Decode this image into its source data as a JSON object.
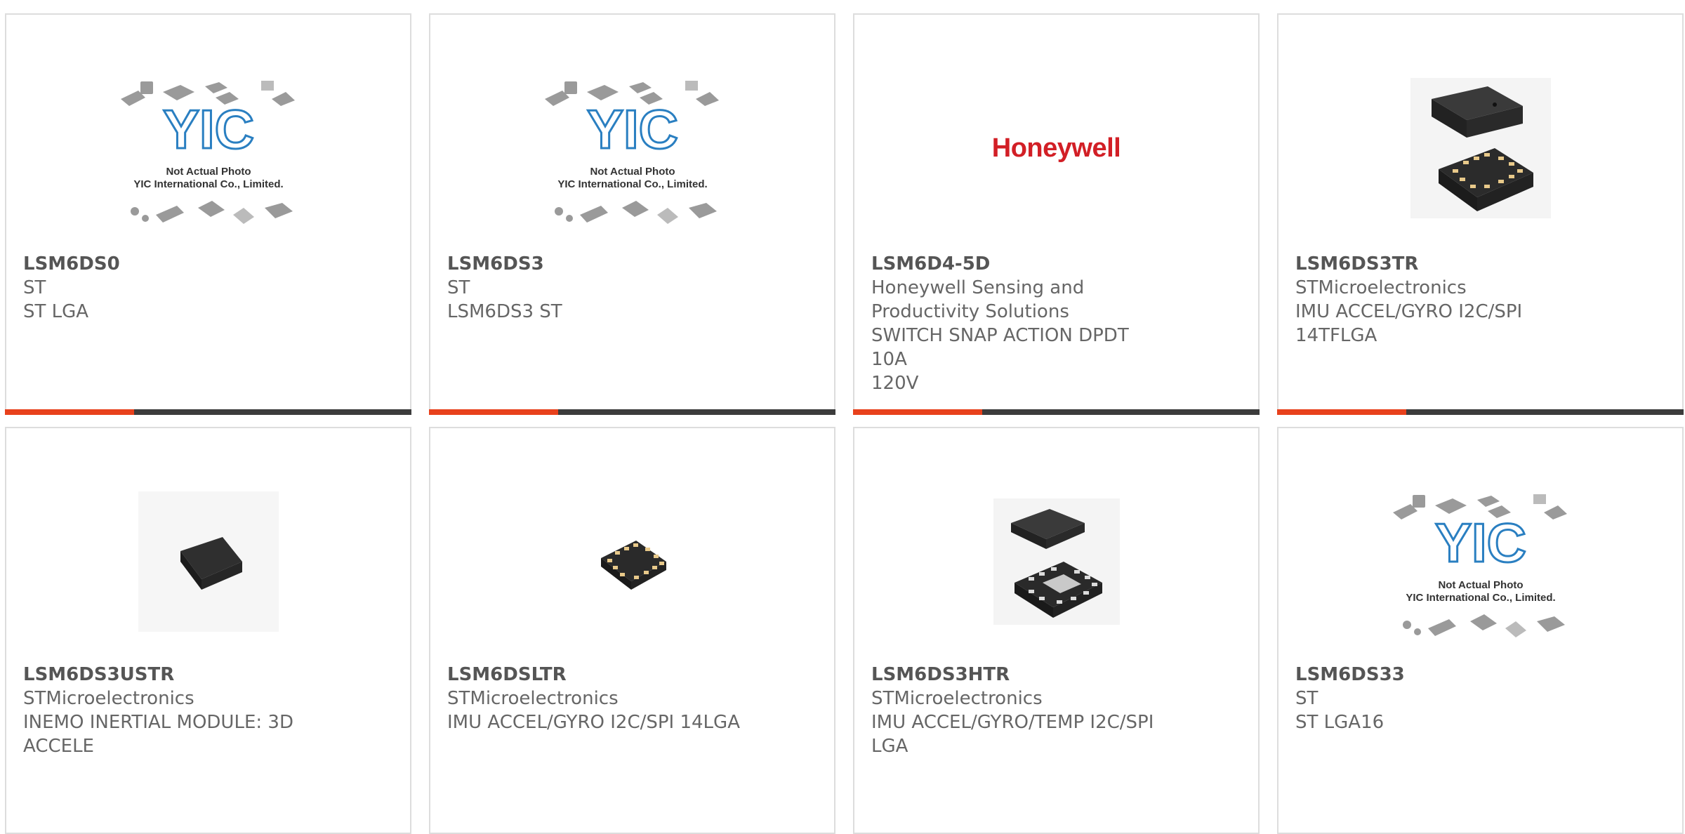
{
  "brand_colors": {
    "accent": "#e8411c",
    "bar_dark": "#3c3c3c",
    "honeywell_red": "#d21f26",
    "yic_blue": "#2a7fc1"
  },
  "placeholder": {
    "logo_text": "YIC",
    "line1": "Not Actual Photo",
    "line2": "YIC International Co., Limited."
  },
  "honeywell_logo": "Honeywell",
  "products": [
    {
      "part": "LSM6DS0",
      "lines": [
        "ST",
        "ST LGA"
      ],
      "image": "yic-placeholder-icon"
    },
    {
      "part": "LSM6DS3",
      "lines": [
        "ST",
        "LSM6DS3 ST"
      ],
      "image": "yic-placeholder-icon"
    },
    {
      "part": "LSM6D4-5D",
      "lines": [
        "Honeywell Sensing and",
        "Productivity Solutions",
        "SWITCH SNAP ACTION DPDT 10A",
        "120V"
      ],
      "image": "honeywell-logo"
    },
    {
      "part": "LSM6DS3TR",
      "lines": [
        "STMicroelectronics",
        "IMU ACCEL/GYRO I2C/SPI",
        "14TFLGA"
      ],
      "image": "lga-chip-exploded-icon"
    },
    {
      "part": "LSM6DS3USTR",
      "lines": [
        "STMicroelectronics",
        "INEMO INERTIAL MODULE: 3D",
        "ACCELE"
      ],
      "image": "black-chip-icon"
    },
    {
      "part": "LSM6DSLTR",
      "lines": [
        "STMicroelectronics",
        "IMU ACCEL/GYRO I2C/SPI 14LGA"
      ],
      "image": "lga-chip-icon"
    },
    {
      "part": "LSM6DS3HTR",
      "lines": [
        "STMicroelectronics",
        "IMU ACCEL/GYRO/TEMP I2C/SPI",
        "LGA"
      ],
      "image": "lga-chip-exploded-icon"
    },
    {
      "part": "LSM6DS33",
      "lines": [
        "ST",
        "ST LGA16"
      ],
      "image": "yic-placeholder-icon"
    }
  ]
}
